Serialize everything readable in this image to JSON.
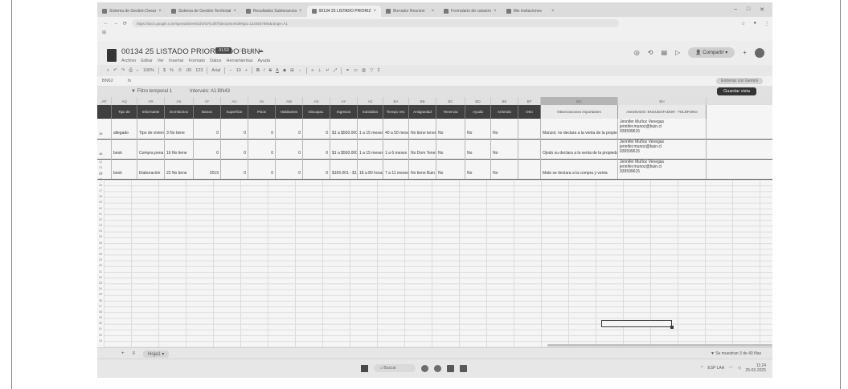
{
  "browser": {
    "tabs": [
      {
        "label": "Sistema de Gestión Desar"
      },
      {
        "label": "Sistema de Gestión Territorial"
      },
      {
        "label": "Resultados Subtenancia"
      },
      {
        "label": "00134 25 LISTADO PRIORIZ"
      },
      {
        "label": "Borrador Reunion"
      },
      {
        "label": "Formulario de catastro"
      },
      {
        "label": "Mis invitaciones"
      }
    ],
    "url": "https://docs.google.com/spreadsheets/d/1Ni7lcuf8Tbbsnpsm/edit#gid=1234567890&range=A1",
    "window_controls": [
      "–",
      "□",
      "✕"
    ]
  },
  "document": {
    "title": "00134 25 LISTADO PRIORIZADO BUIN",
    "file_badge": ".XLSX",
    "menus": [
      "Archivo",
      "Editar",
      "Ver",
      "Insertar",
      "Formato",
      "Datos",
      "Herramientas",
      "Ayuda"
    ],
    "share_label": "Compartir",
    "toolbar": {
      "zoom": "100%",
      "font": "Arial",
      "font_size": "10"
    },
    "cell_ref": "BN62",
    "formula_value": "",
    "right_button": "Entrenar con Gemini"
  },
  "filter_bar": {
    "filter_label": "Filtro temporal 1",
    "range_label": "Intervalo: A1:BN43",
    "save_label": "Guardar vista"
  },
  "columns": [
    "AP",
    "AQ",
    "AR",
    "AS",
    "AT",
    "AU",
    "AV",
    "AW",
    "AX",
    "AY",
    "AZ",
    "BA",
    "BB",
    "BC",
    "BD",
    "BE",
    "BF",
    "BG",
    "BH"
  ],
  "header_row": [
    "",
    "Tipo de",
    "Informante",
    "Dormitorios",
    "Banos",
    "Superficie",
    "Pisos",
    "Habitantes",
    "Discapac.",
    "Ingresos",
    "Subsidios",
    "Tiempo res.",
    "Antigüedad",
    "Tenencia",
    "Ayuda",
    "Arriendo",
    "Otro",
    "Observaciones importantes",
    "ASIGNADO: ENCUESTADOR - TELÉFONO"
  ],
  "rows": [
    {
      "num": "15",
      "cells": [
        "allegado",
        "Tipo de vivienda",
        "3 No tiene",
        "0",
        "0",
        "0",
        "0",
        "0",
        "$1 a $500.000",
        "1 a 15 meses",
        "40 a 50 meses",
        "No tiene tenencia",
        "No",
        "No",
        "No",
        "",
        "Manzol, no declara a la venta de la propiedad"
      ],
      "assigned": [
        "Jennifer Muñoz Venegas",
        "jennifer.munoz@buin.cl",
        "939599615"
      ]
    },
    {
      "num": "16",
      "cells": [
        "book",
        "Compra pena",
        "16 No tiene",
        "0",
        "0",
        "0",
        "0",
        "0",
        "$1 a $500.000",
        "1 a 15 meses",
        "1 a 6 meses",
        "No Dom Tenencia",
        "No",
        "No",
        "No",
        "",
        "Ojodo su declara a la venta de la propiedad"
      ],
      "assigned": [
        "Jennifer Muñoz Venegas",
        "jennifer.munoz@buin.cl",
        "939599615"
      ]
    },
    {
      "num": "17",
      "cells": [
        "book",
        "Elaboración",
        "22 No tiene",
        "2019",
        "0",
        "0",
        "0",
        "0",
        "$165.001 - $1",
        "18 a 80 horas",
        "7 a 11 meses",
        "No tiene Buin",
        "No",
        "No",
        "No",
        "",
        "Mate se declara a la compra y venta"
      ],
      "assigned": [
        "Jennifer Muñoz Venegas",
        "jennifer.munoz@buin.cl",
        "939599615"
      ]
    }
  ],
  "row_numbers": [
    "12",
    "13",
    "14",
    "15",
    "16",
    "17",
    "18",
    "19",
    "20",
    "21",
    "22",
    "23",
    "24",
    "25",
    "26",
    "27",
    "28",
    "29",
    "30",
    "31",
    "32",
    "33",
    "34",
    "35",
    "36",
    "37",
    "38",
    "39",
    "40",
    "41",
    "42",
    "43"
  ],
  "sheet_tab": "Hoja1",
  "status_text": "Se muestran 3 de 40 filas",
  "taskbar": {
    "search_placeholder": "Buscar",
    "time": "11:24",
    "date": "25-03-2025",
    "lang": "ESP LAA"
  }
}
